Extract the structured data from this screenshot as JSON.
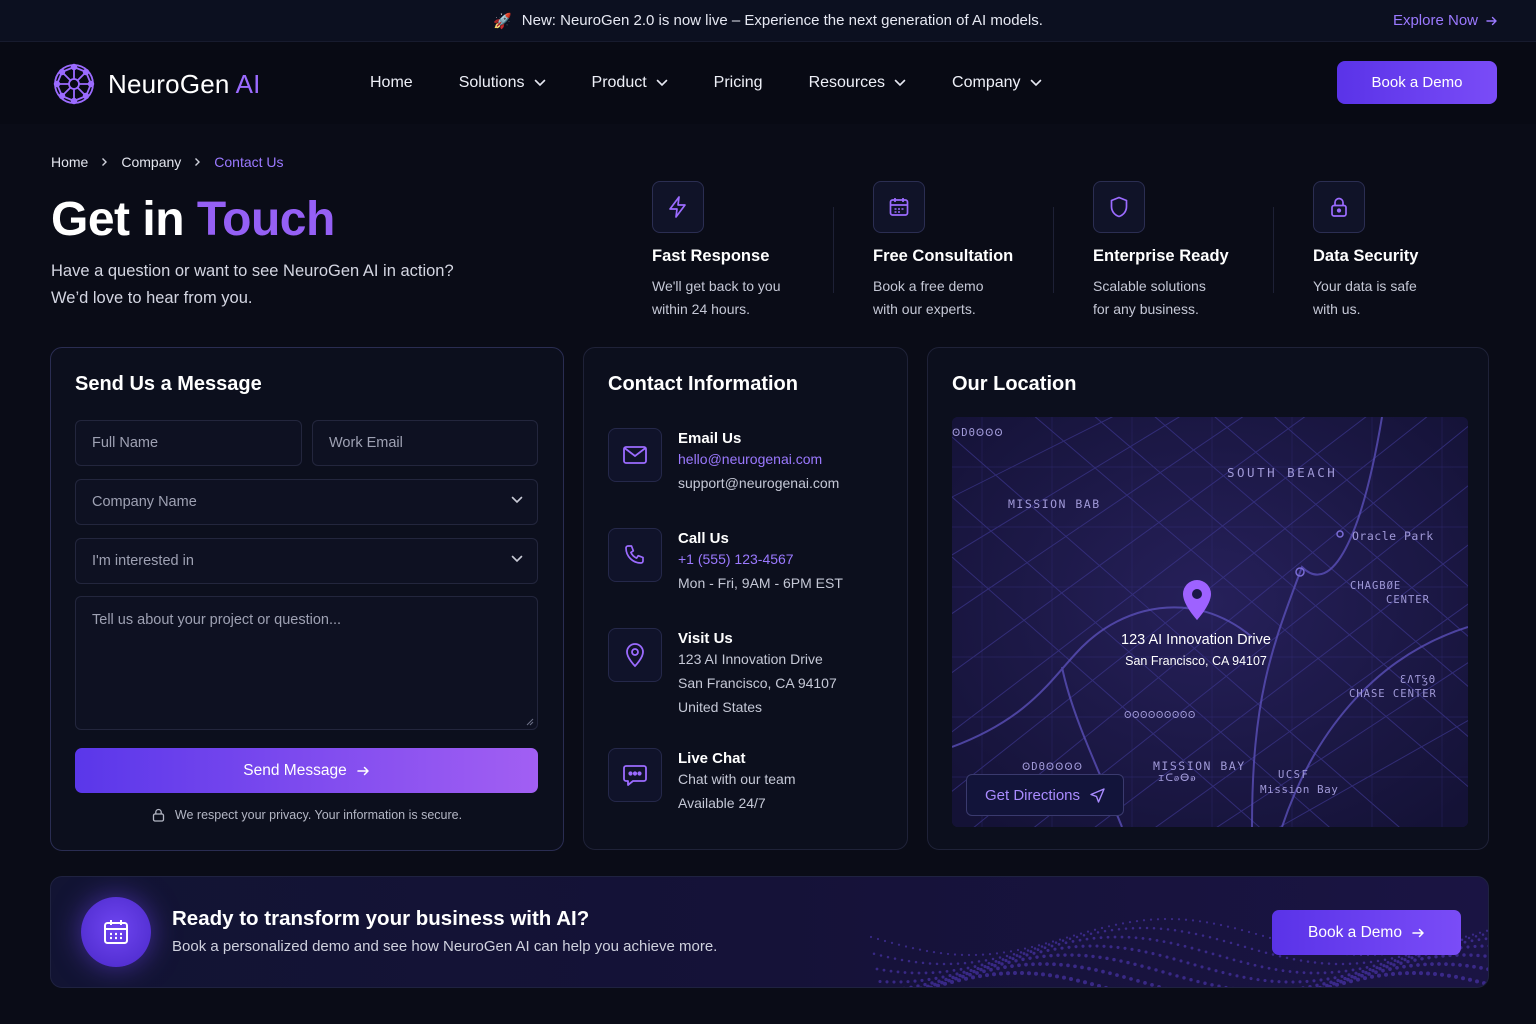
{
  "announcement": {
    "icon": "rocket-icon",
    "text": "New: NeuroGen 2.0 is now live – Experience the next generation of AI models.",
    "link": "Explore Now"
  },
  "brand": {
    "name": "NeuroGen",
    "suffix": "AI",
    "accent": "#9b6bff"
  },
  "nav": {
    "items": [
      {
        "label": "Home",
        "dropdown": false
      },
      {
        "label": "Solutions",
        "dropdown": true
      },
      {
        "label": "Product",
        "dropdown": true
      },
      {
        "label": "Pricing",
        "dropdown": false
      },
      {
        "label": "Resources",
        "dropdown": true
      },
      {
        "label": "Company",
        "dropdown": true
      }
    ],
    "cta": "Book a Demo"
  },
  "breadcrumb": [
    "Home",
    "Company",
    "Contact Us"
  ],
  "hero": {
    "title_plain": "Get in",
    "title_accent": "Touch",
    "line1": "Have a question or want to see NeuroGen AI in action?",
    "line2": "We’d love to hear from you."
  },
  "features": [
    {
      "icon": "lightning-icon",
      "title": "Fast Response",
      "line1": "We'll get back to you",
      "line2": "within 24 hours."
    },
    {
      "icon": "calendar-icon",
      "title": "Free Consultation",
      "line1": "Book a free demo",
      "line2": "with our experts."
    },
    {
      "icon": "shield-icon",
      "title": "Enterprise Ready",
      "line1": "Scalable solutions",
      "line2": "for any business."
    },
    {
      "icon": "lock-icon",
      "title": "Data Security",
      "line1": "Your data is safe",
      "line2": "with us."
    }
  ],
  "form": {
    "title": "Send Us a Message",
    "full_name_placeholder": "Full Name",
    "email_placeholder": "Work Email",
    "company_placeholder": "Company Name",
    "interest_placeholder": "I'm interested in",
    "message_placeholder": "Tell us about your project or question...",
    "submit": "Send Message",
    "privacy": "We respect your privacy. Your information is secure."
  },
  "contact": {
    "title": "Contact Information",
    "email": {
      "title": "Email Us",
      "primary": "hello@neurogenai.com",
      "secondary": "support@neurogenai.com"
    },
    "phone": {
      "title": "Call Us",
      "primary": "+1 (555) 123-4567",
      "secondary": "Mon - Fri, 9AM - 6PM EST"
    },
    "visit": {
      "title": "Visit Us",
      "line1": "123 AI Innovation Drive",
      "line2": "San Francisco, CA 94107",
      "line3": "United States"
    },
    "chat": {
      "title": "Live Chat",
      "line1": "Chat with our team",
      "line2": "Available 24/7"
    }
  },
  "location": {
    "title": "Our Location",
    "pin_line1": "123 AI Innovation Drive",
    "pin_line2": "San Francisco, CA 94107",
    "labels": [
      "SOUTH BEACH",
      "MISSION BAB",
      "Oracle Park",
      "CHAGBØE",
      "CENTER",
      "ƐΛƬꝢΘ",
      "CHASE CENTER",
      "MISSION BAY",
      "UCSF",
      "Mission Bay",
      "ꙨDΘꙨꙨꙨ",
      "ꙨDΘꙨꙨꙨꙨ",
      "ɪᑕꭷⴱꭷ",
      "ꙨꙨꙨꙨꙨꙨꙨꙨꙨ"
    ],
    "directions": "Get Directions"
  },
  "cta_banner": {
    "title": "Ready to transform your business with AI?",
    "subtitle": "Book a personalized demo and see how NeuroGen AI can help you achieve more.",
    "button": "Book a Demo"
  }
}
